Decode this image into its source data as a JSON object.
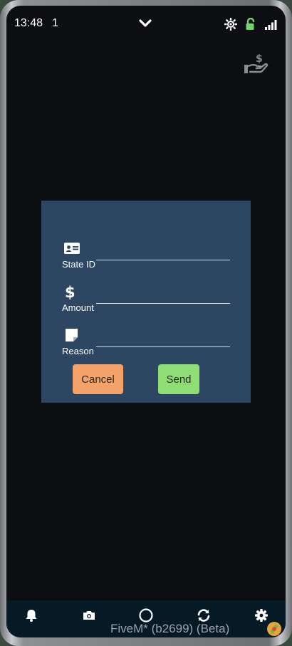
{
  "status_bar": {
    "time": "13:48",
    "notification_count": "1",
    "chevron_icon": "chevron-down-icon",
    "brightness_icon": "brightness-icon",
    "lock_icon": "unlock-icon",
    "signal_icon": "signal-icon",
    "lock_color": "#6fd36a"
  },
  "app": {
    "bank_icon": "hand-money-icon"
  },
  "form": {
    "fields": [
      {
        "label": "State ID",
        "icon": "id-card-icon",
        "value": ""
      },
      {
        "label": "Amount",
        "icon": "dollar-icon",
        "value": ""
      },
      {
        "label": "Reason",
        "icon": "note-icon",
        "value": ""
      }
    ],
    "cancel_label": "Cancel",
    "send_label": "Send",
    "cancel_color": "#f3a26a",
    "send_color": "#8fdd75",
    "background": "#2d4661"
  },
  "nav": {
    "items": [
      "bell-icon",
      "camera-icon",
      "home-circle-icon",
      "refresh-icon",
      "gear-icon"
    ]
  },
  "watermark": {
    "text": "FiveM* (b2699) (Beta)"
  }
}
